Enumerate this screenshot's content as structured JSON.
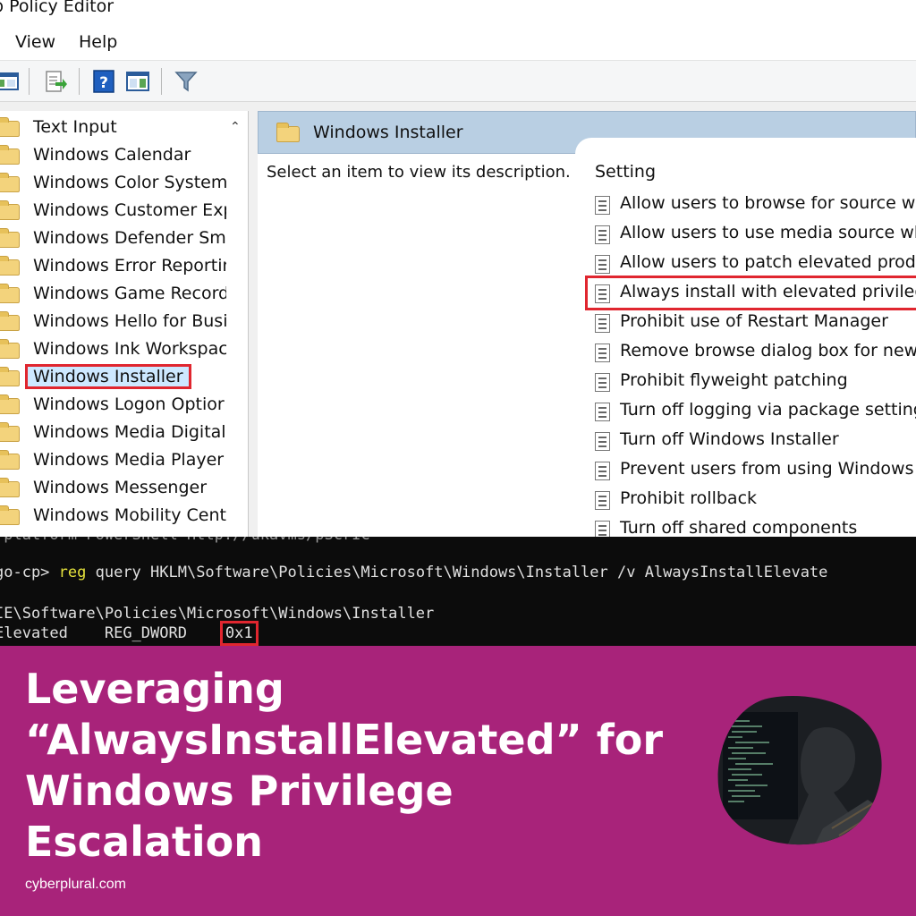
{
  "window": {
    "title": "p Policy Editor",
    "menu": [
      "View",
      "Help"
    ]
  },
  "toolbar": {
    "icons": [
      "console-tree-icon",
      "export-list-icon",
      "help-icon",
      "show-hide-icon",
      "filter-icon"
    ]
  },
  "tree": {
    "items": [
      "Text Input",
      "Windows Calendar",
      "Windows Color System",
      "Windows Customer Exp",
      "Windows Defender Sma",
      "Windows Error Reportin",
      "Windows Game Record",
      "Windows Hello for Busi",
      "Windows Ink Workspac",
      "Windows Installer",
      "Windows Logon Optior",
      "Windows Media Digital",
      "Windows Media Player",
      "Windows Messenger",
      "Windows Mobility Cent"
    ],
    "selected": "Windows Installer"
  },
  "right_pane": {
    "header": "Windows Installer",
    "description_hint": "Select an item to view its description.",
    "settings_header": "Setting",
    "settings": [
      "Allow users to browse for source whi",
      "Allow users to use media source whil",
      "Allow users to patch elevated produc",
      "Always install with elevated privilege",
      "Prohibit use of Restart Manager",
      "Remove browse dialog box for new s",
      "Prohibit flyweight patching",
      "Turn off logging via package settings",
      "Turn off Windows Installer",
      "Prevent users from using Windows Ir",
      "Prohibit rollback",
      "Turn off shared components"
    ],
    "highlighted_setting": "Always install with elevated privilege"
  },
  "terminal": {
    "line0": " platform PowerShell Http://ukavms/pScrIC",
    "prompt": "go-cp> ",
    "command": "reg",
    "args": " query HKLM\\Software\\Policies\\Microsoft\\Windows\\Installer /v AlwaysInstallElevate",
    "key_path": "IE\\Software\\Policies\\Microsoft\\Windows\\Installer",
    "value_name": "Elevated",
    "value_type": "REG_DWORD",
    "value_data": "0x1"
  },
  "banner": {
    "headline": [
      "Leveraging",
      "“AlwaysInstallElevated” for",
      "Windows Privilege",
      "Escalation"
    ],
    "site": "cyberplural.com",
    "bg_color": "#a8237a"
  },
  "colors": {
    "highlight_red": "#e0262f",
    "header_blue": "#b9cfe3",
    "terminal_bg": "#0c0c0c",
    "terminal_keyword": "#e6e33c"
  }
}
